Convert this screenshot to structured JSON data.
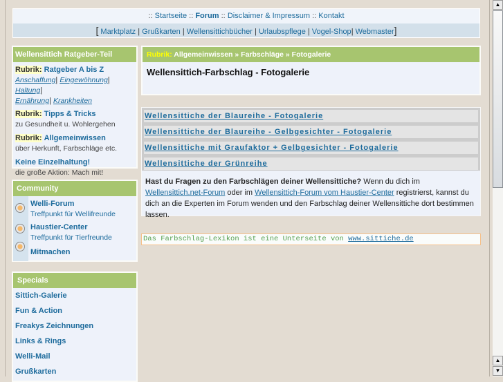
{
  "topnav": {
    "sep": "::",
    "items": [
      "Startseite",
      "Forum",
      "Disclaimer & Impressum",
      "Kontakt"
    ]
  },
  "subnav": {
    "items": [
      "Marktplatz",
      "Grußkarten",
      "Wellensittichbücher",
      "Urlaubspflege",
      "Vogel-Shop",
      "Webmaster"
    ]
  },
  "ratgeber": {
    "title": "Wellensittich Ratgeber-Teil",
    "rubrik": "Rubrik:",
    "sections": [
      {
        "link": "Ratgeber A bis Z",
        "sublinks": [
          "Anschaffung",
          "Eingewöhnung",
          "Haltung",
          "Ernährung",
          "Krankheiten"
        ]
      },
      {
        "link": "Tipps & Tricks",
        "desc": "zu Gesundheit u. Wohlergehen"
      },
      {
        "link": "Allgemeinwissen",
        "desc": "über Herkunft, Farbschläge etc."
      },
      {
        "link": "Keine Einzelhaltung!",
        "desc": "die große Aktion: Mach mit!"
      }
    ]
  },
  "community": {
    "title": "Community",
    "items": [
      {
        "label": "Welli-Forum",
        "desc": "Treffpunkt für Wellifreunde"
      },
      {
        "label": "Haustier-Center",
        "desc": "Treffpunkt für Tierfreunde"
      },
      {
        "label": "Mitmachen"
      }
    ]
  },
  "specials": {
    "title": "Specials",
    "items": [
      "Sittich-Galerie",
      "Fun & Action",
      "Freakys Zeichnungen",
      "Links & Rings",
      "Welli-Mail",
      "Grußkarten"
    ]
  },
  "main": {
    "rubrik": "Rubrik:",
    "breadcrumb": "Allgemeinwissen » Farbschläge »  Fotogalerie",
    "title": "Wellensittich-Farbschlag - Fotogalerie"
  },
  "gallery_links": [
    "Wellensittiche der Blaureihe - Fotogalerie",
    "Wellensittiche der Blaureihe - Gelbgesichter - Fotogalerie",
    "Wellensittiche mit Graufaktor + Gelbgesichter - Fotogalerie",
    "Wellensittiche der Grünreihe"
  ],
  "question": {
    "bold": "Hast du Fragen zu den Farbschlägen deiner Wellensittiche?",
    "t1": " Wenn du dich im ",
    "link1": "Wellensittich.net-Forum",
    "t2": " oder im ",
    "link2": "Wellensittich-Forum vom Haustier-Center",
    "t3": " registrierst, kannst du dich an die Experten im Forum wenden und den Farbschlag deiner Wellensittiche dort bestimmen lassen."
  },
  "footer": {
    "text": "Das Farbschlag-Lexikon ist eine Unterseite von ",
    "link": "www.sittiche.de"
  }
}
